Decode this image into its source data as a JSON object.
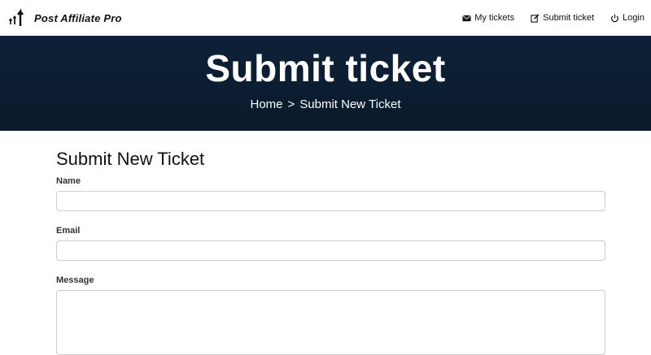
{
  "brand": {
    "name": "Post Affiliate Pro",
    "logo_icon": "trend-arrows-icon"
  },
  "nav": [
    {
      "label": "My tickets",
      "icon": "envelope-icon"
    },
    {
      "label": "Submit ticket",
      "icon": "edit-icon"
    },
    {
      "label": "Login",
      "icon": "power-icon"
    }
  ],
  "hero": {
    "title": "Submit ticket",
    "breadcrumb": {
      "home": "Home",
      "separator": ">",
      "current": "Submit New Ticket"
    },
    "background_color": "#0e2138"
  },
  "form": {
    "heading": "Submit New Ticket",
    "name_label": "Name",
    "name_value": "",
    "email_label": "Email",
    "email_value": "",
    "message_label": "Message",
    "message_value": ""
  }
}
